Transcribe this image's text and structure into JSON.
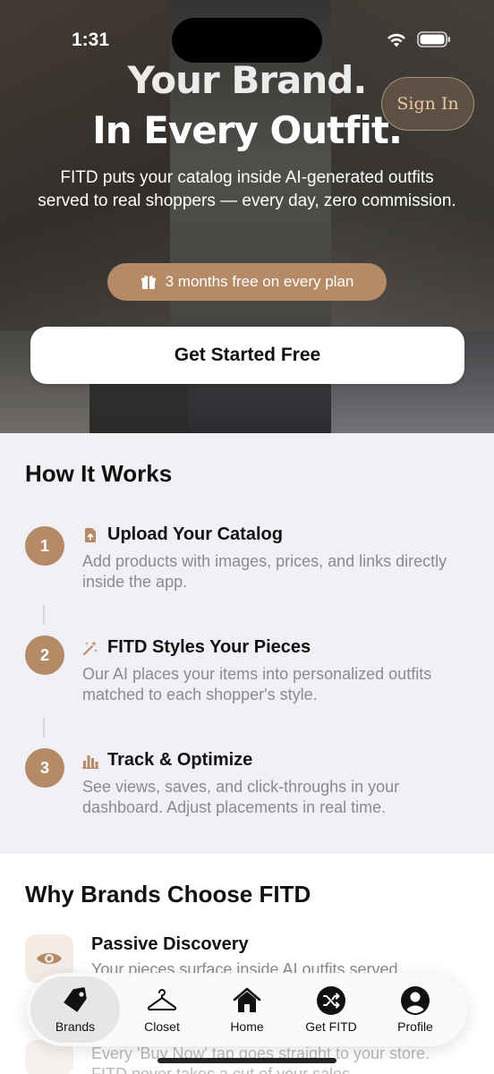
{
  "status_bar": {
    "time": "1:31"
  },
  "hero": {
    "title_line1": "Your Brand.",
    "title_line2": "In Every Outfit.",
    "sign_in_label": "Sign In",
    "subtitle": "FITD puts your catalog inside AI-generated outfits served to real shoppers — every day, zero commission.",
    "promo": "3 months free on every plan",
    "cta_label": "Get Started Free"
  },
  "how_it_works": {
    "title": "How It Works",
    "steps": [
      {
        "number": "1",
        "icon": "upload-doc-icon",
        "title": "Upload Your Catalog",
        "description": "Add products with images, prices, and links directly inside the app."
      },
      {
        "number": "2",
        "icon": "sparkle-wand-icon",
        "title": "FITD Styles Your Pieces",
        "description": "Our AI places your items into personalized outfits matched to each shopper's style."
      },
      {
        "number": "3",
        "icon": "bar-chart-icon",
        "title": "Track & Optimize",
        "description": "See views, saves, and click-throughs in your dashboard. Adjust placements in real time."
      }
    ]
  },
  "why": {
    "title": "Why Brands Choose FITD",
    "item": {
      "icon": "eye-icon",
      "title": "Passive Discovery",
      "description": "Your pieces surface inside AI outfits served"
    },
    "partial_text": "Every 'Buy Now' tap goes straight to your store. FITD never takes a cut of your sales."
  },
  "tabbar": {
    "tabs": [
      {
        "label": "Brands",
        "icon": "tag-icon",
        "active": true
      },
      {
        "label": "Closet",
        "icon": "hanger-icon",
        "active": false
      },
      {
        "label": "Home",
        "icon": "home-icon",
        "active": false
      },
      {
        "label": "Get FITD",
        "icon": "shuffle-icon",
        "active": false
      },
      {
        "label": "Profile",
        "icon": "profile-icon",
        "active": false
      }
    ]
  },
  "colors": {
    "accent": "#b58a66",
    "section_bg": "#f1f0f5",
    "text_muted": "#8a8a8f"
  }
}
